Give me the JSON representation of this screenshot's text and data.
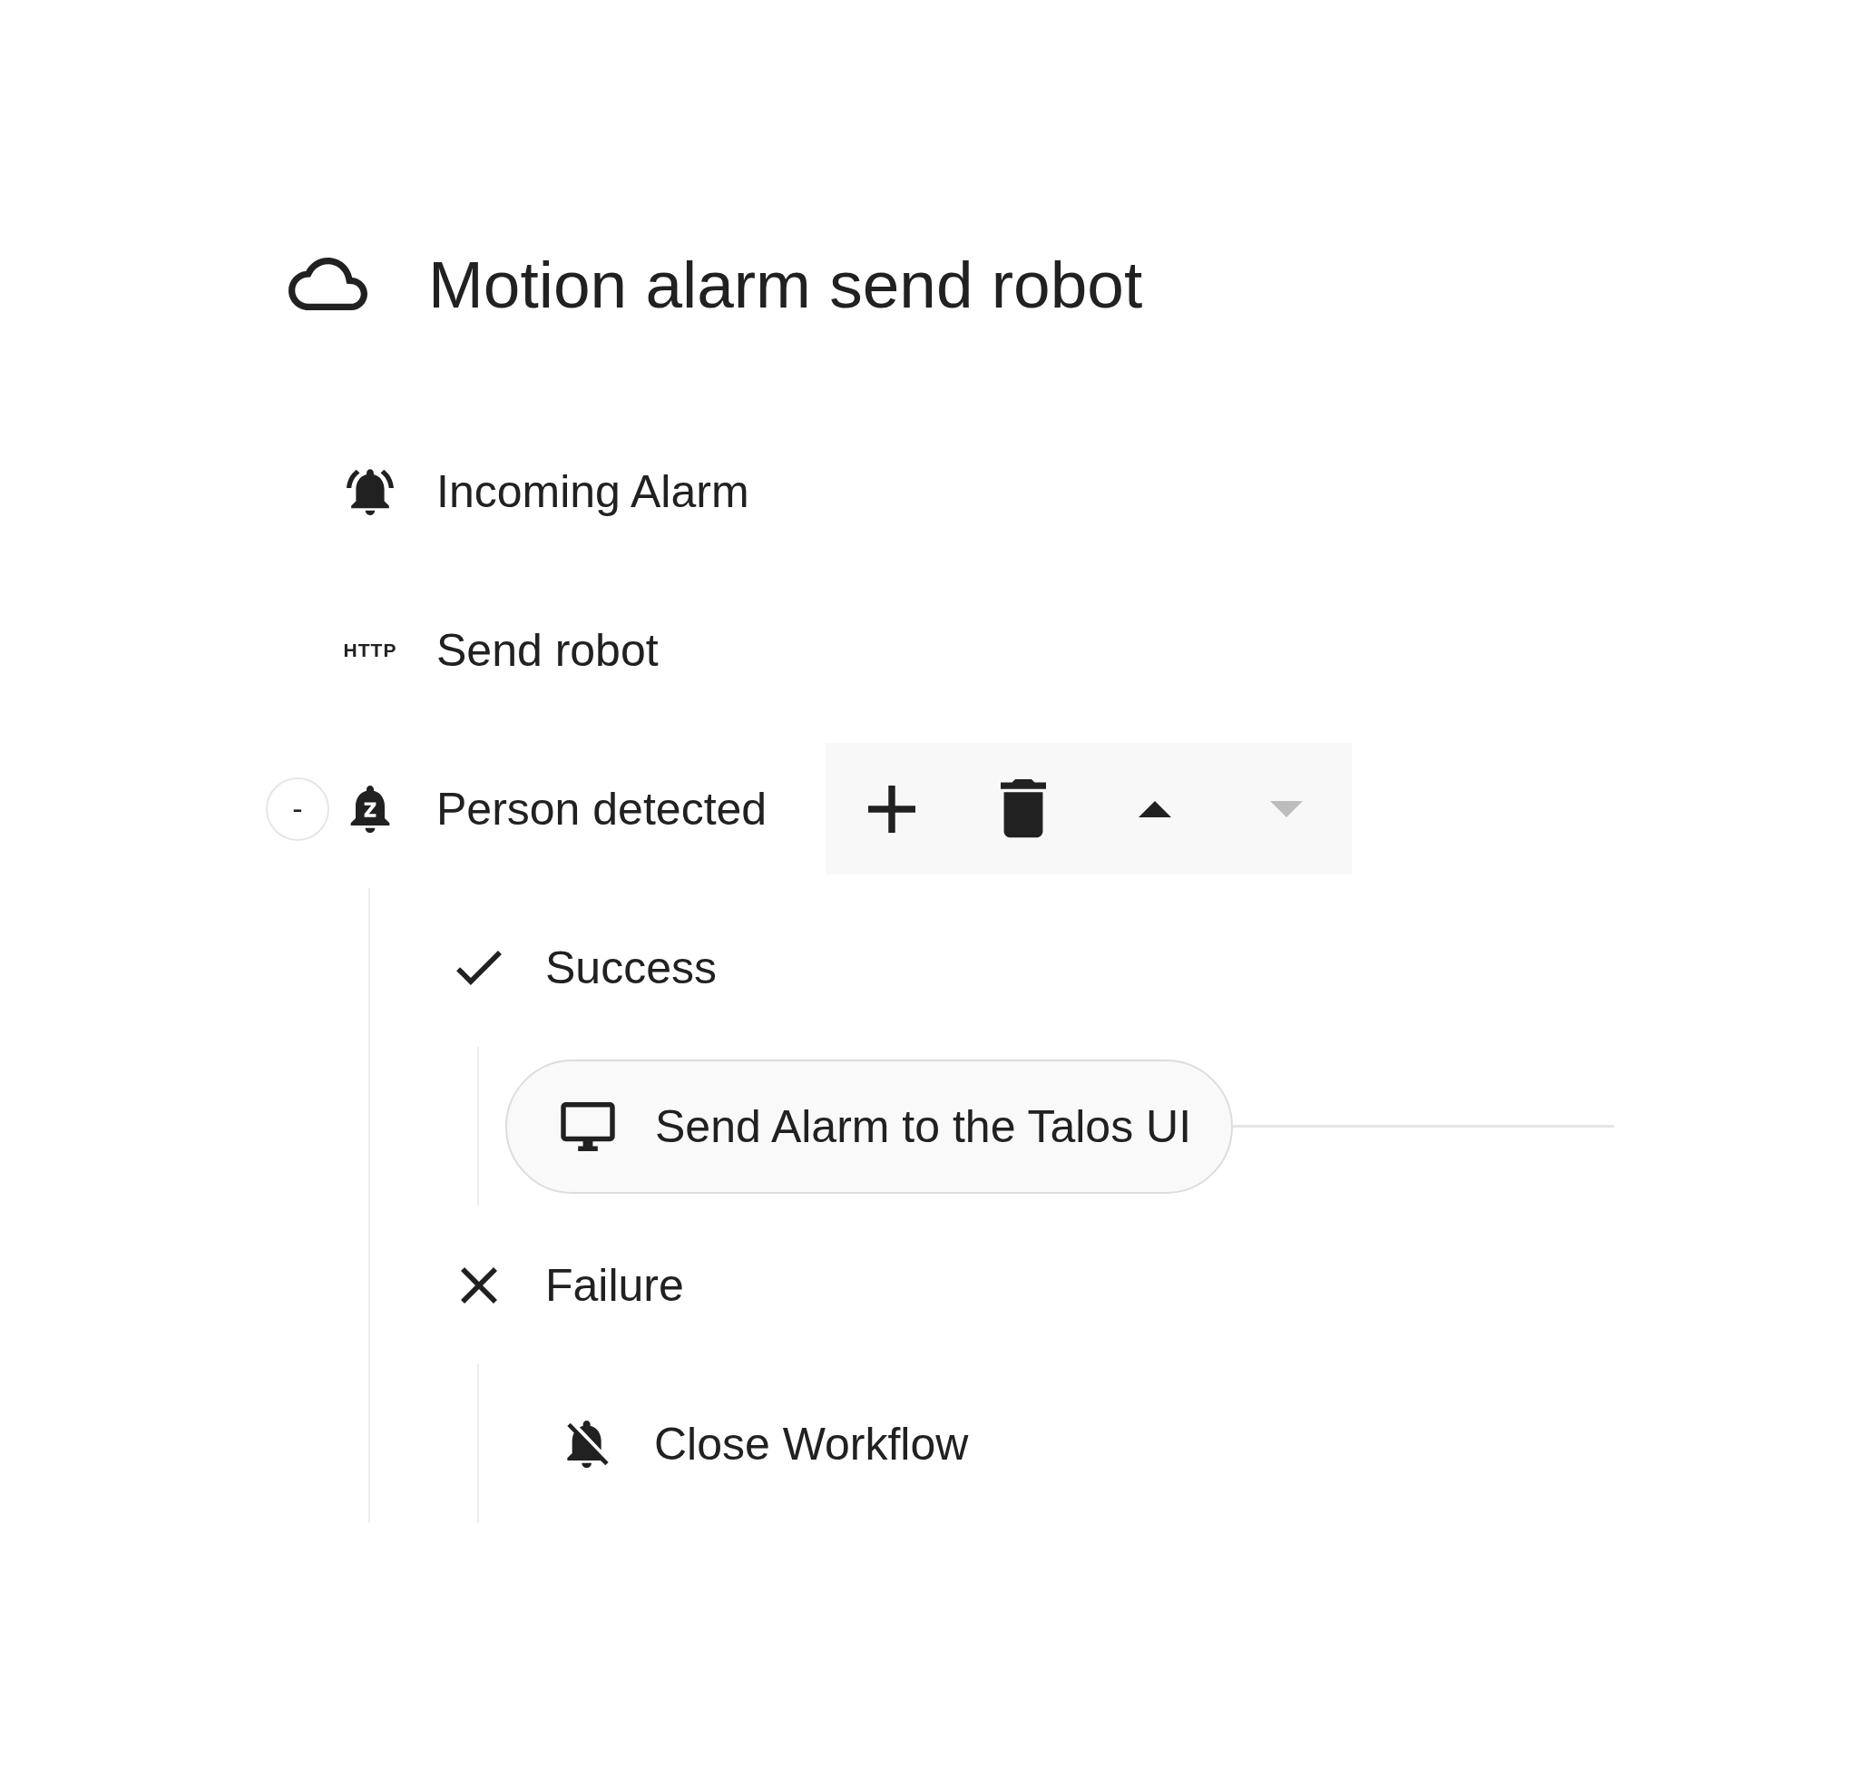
{
  "title": "Motion alarm send robot",
  "nodes": [
    {
      "kind": "alarm",
      "label": "Incoming Alarm"
    },
    {
      "kind": "http",
      "icon_text": "HTTP",
      "label": "Send robot"
    },
    {
      "kind": "snooze",
      "label": "Person detected",
      "toggle": "-",
      "expanded": true,
      "toolbar": [
        {
          "kind": "add",
          "disabled": false
        },
        {
          "kind": "delete",
          "disabled": false
        },
        {
          "kind": "up",
          "disabled": false
        },
        {
          "kind": "down",
          "disabled": true
        }
      ],
      "children": [
        {
          "kind": "success",
          "label": "Success",
          "children": [
            {
              "kind": "display",
              "label": "Send Alarm to the Talos UI"
            }
          ]
        },
        {
          "kind": "failure",
          "label": "Failure",
          "children": [
            {
              "kind": "alarm-off",
              "label": "Close Workflow"
            }
          ]
        }
      ]
    }
  ]
}
